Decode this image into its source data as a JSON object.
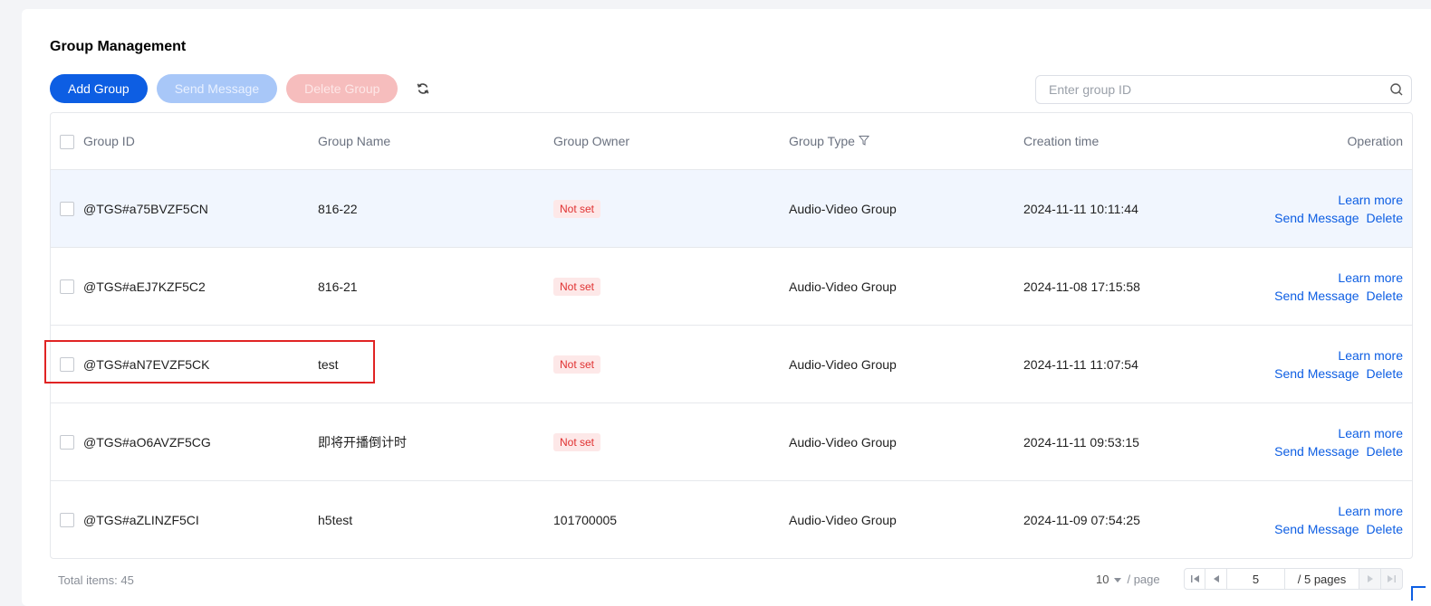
{
  "page": {
    "title": "Group Management"
  },
  "toolbar": {
    "add_group": "Add Group",
    "send_message": "Send Message",
    "delete_group": "Delete Group"
  },
  "search": {
    "placeholder": "Enter group ID"
  },
  "table": {
    "headers": {
      "group_id": "Group ID",
      "group_name": "Group Name",
      "group_owner": "Group Owner",
      "group_type": "Group Type",
      "creation_time": "Creation time",
      "operation": "Operation"
    },
    "rows": [
      {
        "id": "@TGS#a75BVZF5CN",
        "name": "816-22",
        "owner": "Not set",
        "owner_is_badge": true,
        "type": "Audio-Video Group",
        "time": "2024-11-11 10:11:44"
      },
      {
        "id": "@TGS#aEJ7KZF5C2",
        "name": "816-21",
        "owner": "Not set",
        "owner_is_badge": true,
        "type": "Audio-Video Group",
        "time": "2024-11-08 17:15:58"
      },
      {
        "id": "@TGS#aN7EVZF5CK",
        "name": "test",
        "owner": "Not set",
        "owner_is_badge": true,
        "type": "Audio-Video Group",
        "time": "2024-11-11 11:07:54"
      },
      {
        "id": "@TGS#aO6AVZF5CG",
        "name": "即将开播倒计时",
        "owner": "Not set",
        "owner_is_badge": true,
        "type": "Audio-Video Group",
        "time": "2024-11-11 09:53:15"
      },
      {
        "id": "@TGS#aZLINZF5CI",
        "name": "h5test",
        "owner": "101700005",
        "owner_is_badge": false,
        "type": "Audio-Video Group",
        "time": "2024-11-09 07:54:25"
      }
    ],
    "ops": {
      "learn_more": "Learn more",
      "send_message": "Send Message",
      "delete": "Delete"
    }
  },
  "footer": {
    "total": "Total items:  45",
    "page_size": "10",
    "per_page": "/ page",
    "current_page": "5",
    "total_pages": "/ 5 pages"
  },
  "colors": {
    "primary": "#0d5ee3",
    "danger": "#e02424",
    "highlight_row": "#f1f6fe"
  }
}
